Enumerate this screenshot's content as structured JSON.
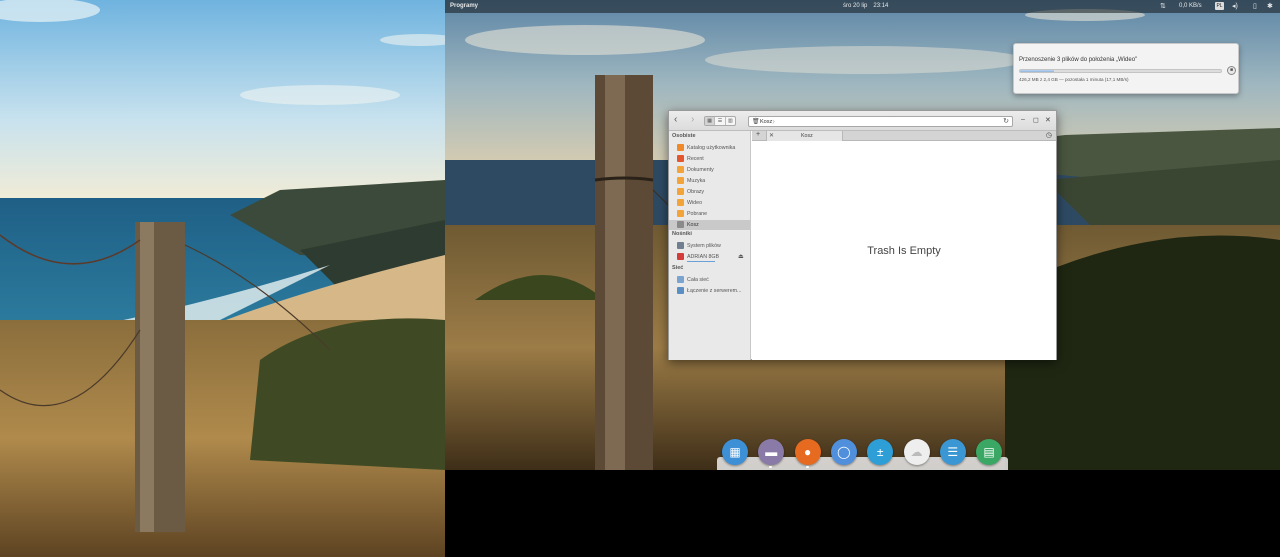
{
  "top_panel": {
    "apps_label": "Programy",
    "date": "śro 20 lip",
    "time": "23:14",
    "net_speed": "0,0 KB/s",
    "keyboard_layout": "PL"
  },
  "transfer": {
    "title": "Przenoszenie 3 plików do położenia „Wideo\"",
    "status": "426,2 MB z 2,4 GB — pozostała 1 minuta (17,1 MB/s)",
    "progress_fraction": 0.17
  },
  "file_manager": {
    "path_crumb": "Kosz",
    "tab_title": "Kosz",
    "empty_message": "Trash Is Empty",
    "sidebar": {
      "personal_heading": "Osobiste",
      "personal_items": [
        {
          "label": "Katalog użytkownika",
          "color": "#f0892a",
          "icon": "home-icon"
        },
        {
          "label": "Recent",
          "color": "#e4572e",
          "icon": "recent-icon"
        },
        {
          "label": "Dokumenty",
          "color": "#f2a33a",
          "icon": "documents-folder-icon"
        },
        {
          "label": "Muzyka",
          "color": "#f2a33a",
          "icon": "music-folder-icon"
        },
        {
          "label": "Obrazy",
          "color": "#f2a33a",
          "icon": "pictures-folder-icon"
        },
        {
          "label": "Wideo",
          "color": "#f2a33a",
          "icon": "videos-folder-icon"
        },
        {
          "label": "Pobrane",
          "color": "#f2a33a",
          "icon": "downloads-folder-icon"
        },
        {
          "label": "Kosz",
          "color": "#8a8a8a",
          "icon": "trash-icon"
        }
      ],
      "devices_heading": "Nośniki",
      "device_items": [
        {
          "label": "System plików",
          "color": "#6f7f8f",
          "icon": "drive-icon"
        },
        {
          "label": "ADRIAN 8GB",
          "color": "#d43c3c",
          "icon": "usb-drive-icon"
        }
      ],
      "network_heading": "Sieć",
      "network_items": [
        {
          "label": "Cała sieć",
          "color": "#7aa4cf",
          "icon": "network-icon"
        },
        {
          "label": "Łączenie z serwerem...",
          "color": "#5b8fc4",
          "icon": "connect-server-icon"
        }
      ]
    }
  },
  "dock": [
    {
      "name": "multitasking-view-icon",
      "color": "#3d8fd6",
      "glyph": "▦"
    },
    {
      "name": "files-icon",
      "color": "#8a7aa8",
      "glyph": "▬"
    },
    {
      "name": "firefox-icon",
      "color": "#e66a1f",
      "glyph": "●"
    },
    {
      "name": "chromium-icon",
      "color": "#4f8fdc",
      "glyph": "◯"
    },
    {
      "name": "calculator-icon",
      "color": "#2e9fd6",
      "glyph": "±"
    },
    {
      "name": "midori-icon",
      "color": "#eeeeee",
      "glyph": "☁"
    },
    {
      "name": "documents-icon",
      "color": "#3a97d4",
      "glyph": "☰"
    },
    {
      "name": "spreadsheet-icon",
      "color": "#3aa864",
      "glyph": "▤"
    }
  ]
}
